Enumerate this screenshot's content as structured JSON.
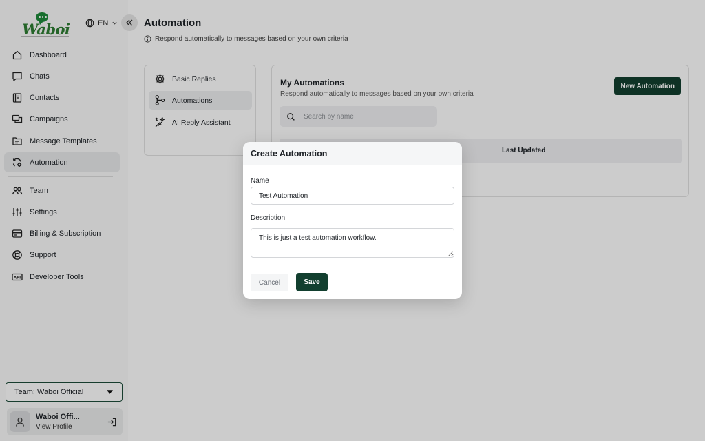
{
  "brand": {
    "name": "Waboi",
    "accent": "#123f2f",
    "logo_green": "#2e7d32"
  },
  "language": {
    "code": "EN",
    "globe_icon": "globe-icon"
  },
  "sidebar": {
    "items": [
      {
        "label": "Dashboard",
        "icon": "home-icon"
      },
      {
        "label": "Chats",
        "icon": "chat-bubble-icon"
      },
      {
        "label": "Contacts",
        "icon": "address-book-icon"
      },
      {
        "label": "Campaigns",
        "icon": "campaigns-icon"
      },
      {
        "label": "Message Templates",
        "icon": "template-icon"
      },
      {
        "label": "Automation",
        "icon": "automation-icon",
        "active": true
      },
      {
        "label": "Team",
        "icon": "team-icon"
      },
      {
        "label": "Settings",
        "icon": "sliders-icon"
      },
      {
        "label": "Billing & Subscription",
        "icon": "credit-card-icon"
      },
      {
        "label": "Support",
        "icon": "lifebuoy-icon"
      },
      {
        "label": "Developer Tools",
        "icon": "api-icon"
      }
    ],
    "team_select": "Team: Waboi Official",
    "profile": {
      "name": "Waboi Offi...",
      "link": "View Profile"
    }
  },
  "header": {
    "title": "Automation",
    "subtitle": "Respond automatically to messages based on your own criteria"
  },
  "subnav": {
    "items": [
      {
        "label": "Basic Replies",
        "icon": "gear-icon"
      },
      {
        "label": "Automations",
        "icon": "branch-icon",
        "active": true
      },
      {
        "label": "AI Reply Assistant",
        "icon": "ai-sparkle-icon"
      }
    ]
  },
  "panel": {
    "title": "My Automations",
    "subtitle": "Respond automatically to messages based on your own criteria",
    "new_button": "New Automation",
    "search_placeholder": "Search by name",
    "columns": {
      "last_updated": "Last Updated"
    }
  },
  "modal": {
    "title": "Create Automation",
    "name_label": "Name",
    "name_value": "Test Automation",
    "description_label": "Description",
    "description_value": "This is just a test automation workflow.",
    "cancel": "Cancel",
    "save": "Save"
  }
}
